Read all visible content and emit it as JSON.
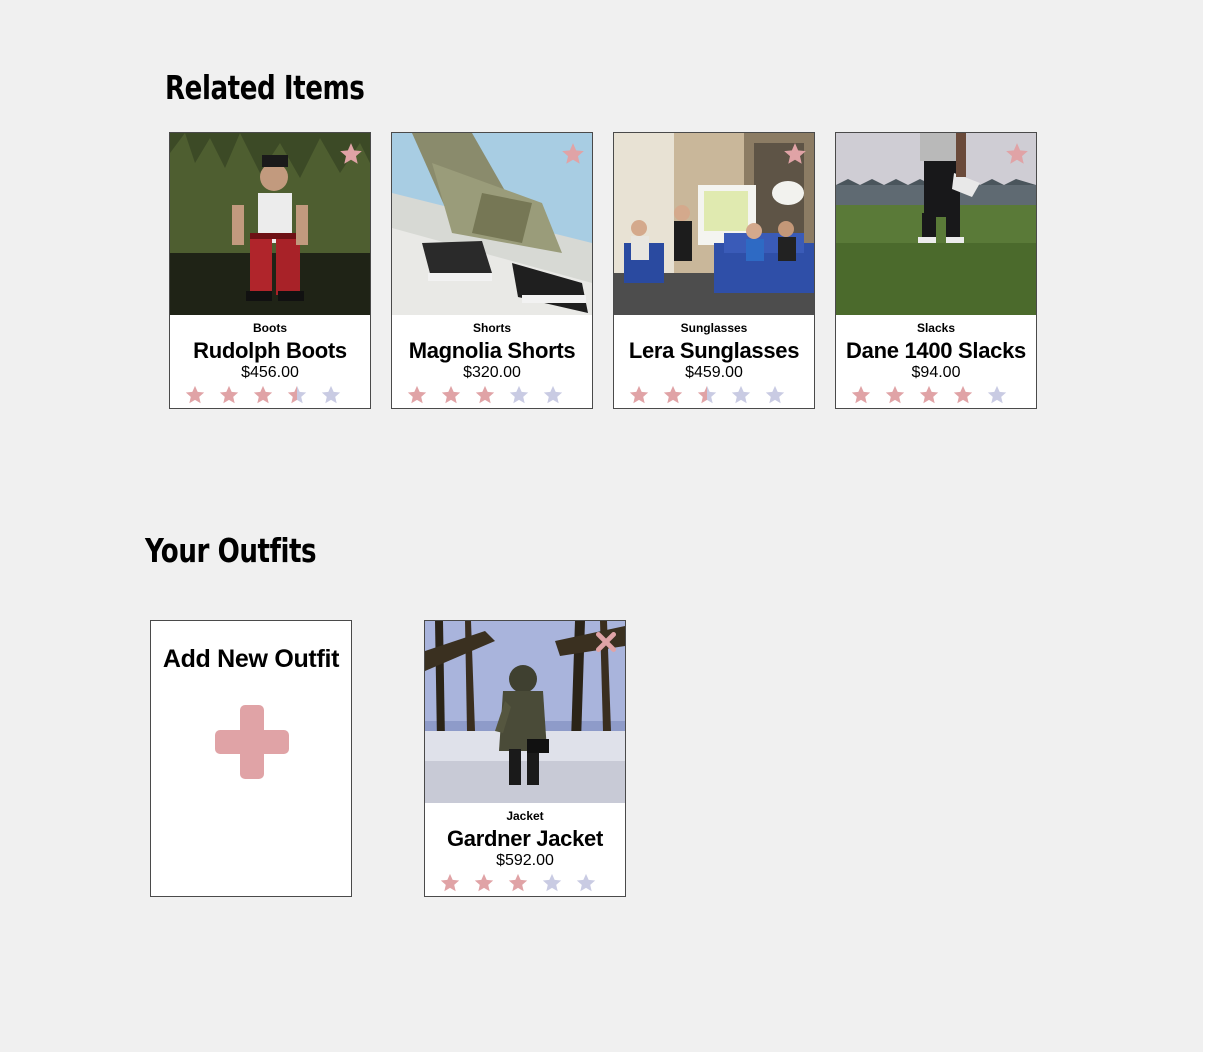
{
  "related": {
    "title": "Related Items",
    "items": [
      {
        "category": "Boots",
        "name": "Rudolph Boots",
        "price": "$456.00",
        "rating": 3.5,
        "action_icon": "star-icon"
      },
      {
        "category": "Shorts",
        "name": "Magnolia Shorts",
        "price": "$320.00",
        "rating": 3,
        "action_icon": "star-icon"
      },
      {
        "category": "Sunglasses",
        "name": "Lera Sunglasses",
        "price": "$459.00",
        "rating": 2.5,
        "action_icon": "star-icon"
      },
      {
        "category": "Slacks",
        "name": "Dane 1400 Slacks",
        "price": "$94.00",
        "rating": 4,
        "action_icon": "star-icon"
      }
    ]
  },
  "outfits": {
    "title": "Your Outfits",
    "add_label": "Add New Outfit",
    "items": [
      {
        "category": "Jacket",
        "name": "Gardner Jacket",
        "price": "$592.00",
        "rating": 3,
        "action_icon": "close-icon"
      }
    ]
  },
  "colors": {
    "background": "#f0f0f0",
    "accent": "#e0a3a6",
    "star_empty": "#c9cbe3"
  }
}
